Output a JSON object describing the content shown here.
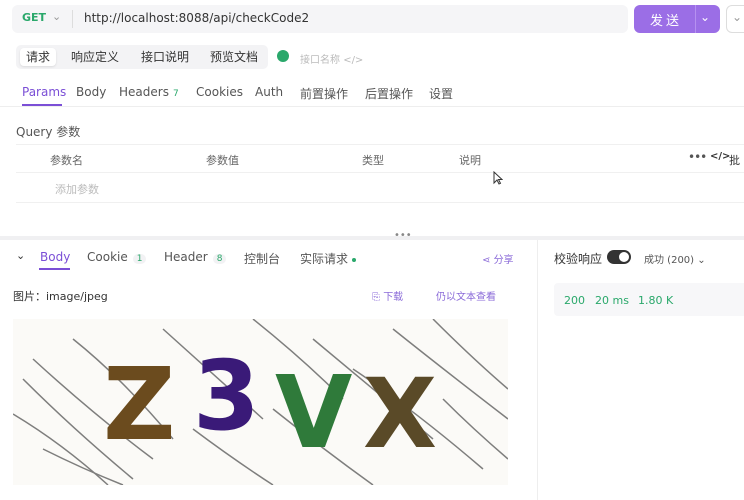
{
  "request": {
    "method": "GET",
    "url": "http://localhost:8088/api/checkCode2",
    "send_label": "发送"
  },
  "doc_tabs": [
    "请求",
    "响应定义",
    "接口说明",
    "预览文档"
  ],
  "name_placeholder": "接口名称",
  "request_tabs": [
    {
      "label": "Params"
    },
    {
      "label": "Body"
    },
    {
      "label": "Headers",
      "count": "7"
    },
    {
      "label": "Cookies"
    },
    {
      "label": "Auth"
    },
    {
      "label": "前置操作"
    },
    {
      "label": "后置操作"
    },
    {
      "label": "设置"
    }
  ],
  "query": {
    "title": "Query 参数",
    "columns": [
      "参数名",
      "参数值",
      "类型",
      "说明"
    ],
    "batch_label": "批",
    "add_param": "添加参数"
  },
  "response_tabs": [
    {
      "label": "Body"
    },
    {
      "label": "Cookie",
      "count": "1"
    },
    {
      "label": "Header",
      "count": "8"
    },
    {
      "label": "控制台"
    },
    {
      "label": "实际请求"
    }
  ],
  "share_label": "分享",
  "body": {
    "image_label": "图片：image/jpeg",
    "download": "下载",
    "view_as_text": "仍以文本查看",
    "captcha_chars": [
      "Z",
      "3",
      "V",
      "X"
    ]
  },
  "validate": {
    "label": "校验响应",
    "status": "成功 (200)"
  },
  "stats": {
    "code": "200",
    "time": "20 ms",
    "size": "1.80 K"
  },
  "colors": {
    "accent": "#7b4fd6",
    "send": "#9b6ee6",
    "success": "#2aa86b"
  }
}
